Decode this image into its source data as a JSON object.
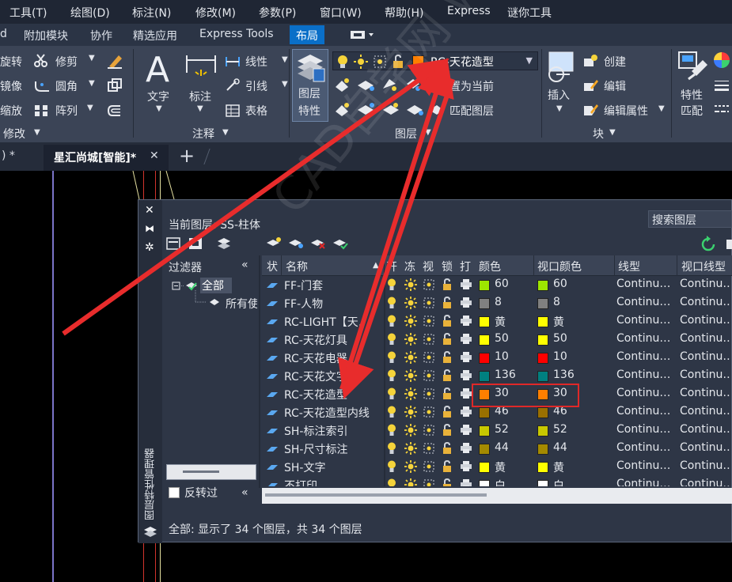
{
  "menu": [
    "工具(T)",
    "绘图(D)",
    "标注(N)",
    "修改(M)",
    "参数(P)",
    "窗口(W)",
    "帮助(H)",
    "Express",
    "谜你工具"
  ],
  "ribbon_tabs": [
    "d",
    "附加模块",
    "协作",
    "精选应用",
    "Express Tools",
    "布局"
  ],
  "ribbon": {
    "modify": {
      "rotate": "旋转",
      "mirror": "镜像",
      "scale": "缩放",
      "trim": "修剪",
      "fillet": "圆角",
      "array": "阵列",
      "panel": "修改"
    },
    "annotation": {
      "text": "文字",
      "dimension": "标注",
      "linear": "线性",
      "leader": "引线",
      "table": "表格",
      "panel": "注释"
    },
    "layers": {
      "properties_line1": "图层",
      "properties_line2": "特性",
      "current_layer": "RC-天花造型",
      "set_current": "置为当前",
      "match_layer": "匹配图层",
      "panel": "图层"
    },
    "block": {
      "insert": "插入",
      "create": "创建",
      "edit": "编辑",
      "edit_attributes": "编辑属性",
      "panel": "块"
    },
    "match": {
      "line1": "特性",
      "line2": "匹配"
    }
  },
  "doc_tabs": {
    "prev_tab": ")  *",
    "current_tab": "星汇尚城[智能]*",
    "close": "✕",
    "new": "+"
  },
  "layer_manager": {
    "title_vertical": "图层特性管理器",
    "current_layer_label": "当前图层: SS-柱体",
    "search_placeholder": "搜索图层",
    "filters_label": "过滤器",
    "collapse": "«",
    "tree_all": "全部",
    "tree_used": "所有使",
    "invert_label": "反转过",
    "status": "全部: 显示了 34 个图层，共 34 个图层",
    "columns": {
      "status": "状",
      "name": "名称",
      "on": "开",
      "freeze": "冻",
      "vp": "视",
      "lock": "锁",
      "plot": "打",
      "color": "颜色",
      "vp_color": "视口颜色",
      "linetype": "线型",
      "vp_linetype": "视口线型"
    },
    "layers": [
      {
        "name": "FF-门套",
        "color": "60",
        "vp_color": "60",
        "linetype": "Continu…",
        "vp_linetype": "Continu…",
        "swatch": "#9ee600"
      },
      {
        "name": "FF-人物",
        "color": "8",
        "vp_color": "8",
        "linetype": "Continu…",
        "vp_linetype": "Continu…",
        "swatch": "#808080"
      },
      {
        "name": "RC-LIGHT【天…",
        "color": "黄",
        "vp_color": "黄",
        "linetype": "Continu…",
        "vp_linetype": "Continu…",
        "swatch": "#ffff00"
      },
      {
        "name": "RC-天花灯具",
        "color": "50",
        "vp_color": "50",
        "linetype": "Continu…",
        "vp_linetype": "Continu…",
        "swatch": "#ffff00"
      },
      {
        "name": "RC-天花电器",
        "color": "10",
        "vp_color": "10",
        "linetype": "Continu…",
        "vp_linetype": "Continu…",
        "swatch": "#ff0000"
      },
      {
        "name": "RC-天花文字",
        "color": "136",
        "vp_color": "136",
        "linetype": "Continu…",
        "vp_linetype": "Continu…",
        "swatch": "#008080"
      },
      {
        "name": "RC-天花造型",
        "color": "30",
        "vp_color": "30",
        "linetype": "Continu…",
        "vp_linetype": "Continu…",
        "swatch": "#ff7f00"
      },
      {
        "name": "RC-天花造型内线",
        "color": "46",
        "vp_color": "46",
        "linetype": "Continu…",
        "vp_linetype": "Continu…",
        "swatch": "#9a7000"
      },
      {
        "name": "SH-标注索引",
        "color": "52",
        "vp_color": "52",
        "linetype": "Continu…",
        "vp_linetype": "Continu…",
        "swatch": "#c8c800"
      },
      {
        "name": "SH-尺寸标注",
        "color": "44",
        "vp_color": "44",
        "linetype": "Continu…",
        "vp_linetype": "Continu…",
        "swatch": "#a48a00"
      },
      {
        "name": "SH-文字",
        "color": "黄",
        "vp_color": "黄",
        "linetype": "Continu…",
        "vp_linetype": "Continu…",
        "swatch": "#ffff00"
      },
      {
        "name": "不打印",
        "color": "白",
        "vp_color": "白",
        "linetype": "Continu…",
        "vp_linetype": "Continu…",
        "swatch": "#ffffff"
      }
    ]
  },
  "watermark": "CAD自学网 www.cadzxw.com",
  "colors": {
    "accent": "#0a6fc8",
    "annotation_red": "#e02828",
    "selected_layer": "#ff7f00"
  }
}
